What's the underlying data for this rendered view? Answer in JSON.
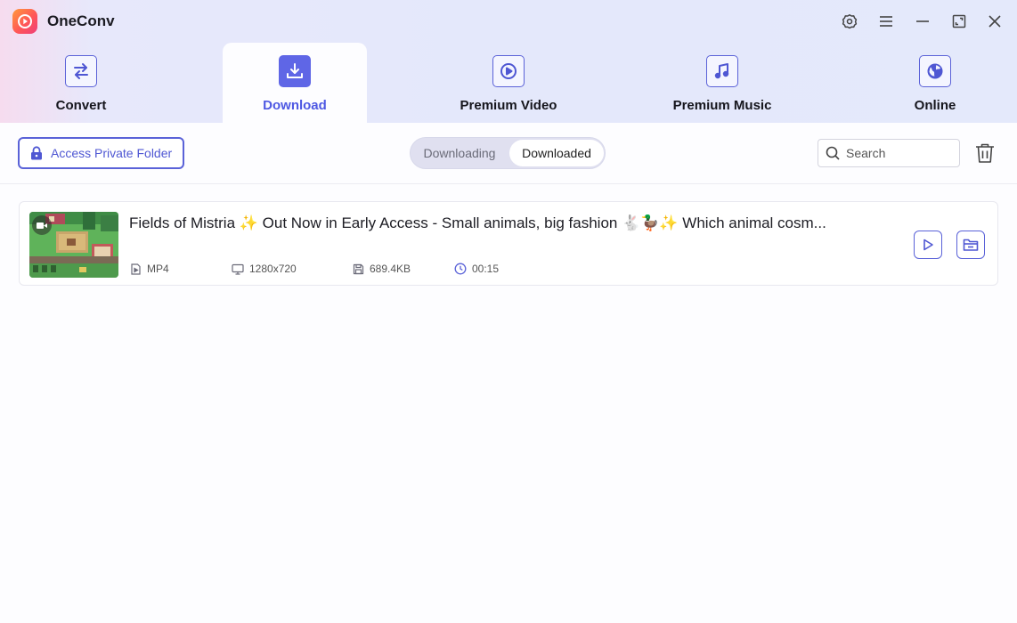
{
  "app": {
    "title": "OneConv"
  },
  "window_controls": [
    {
      "name": "settings-icon"
    },
    {
      "name": "menu-icon"
    },
    {
      "name": "minimize-icon"
    },
    {
      "name": "maximize-icon"
    },
    {
      "name": "close-icon"
    }
  ],
  "nav": {
    "active": "Download",
    "tabs": [
      {
        "label": "Convert",
        "icon": "convert-icon"
      },
      {
        "label": "Download",
        "icon": "download-icon"
      },
      {
        "label": "Premium Video",
        "icon": "play-circle-icon"
      },
      {
        "label": "Premium Music",
        "icon": "music-note-icon"
      },
      {
        "label": "Online",
        "icon": "globe-icon"
      }
    ]
  },
  "toolbar": {
    "private_folder_label": "Access Private Folder",
    "segment": {
      "downloading": "Downloading",
      "downloaded": "Downloaded",
      "selected": "Downloaded"
    },
    "search_placeholder": "Search"
  },
  "downloads": [
    {
      "title": "Fields of Mistria ✨ Out Now in Early Access - Small animals, big fashion 🐇🦆✨ Which animal cosm...",
      "format": "MP4",
      "resolution": "1280x720",
      "size": "689.4KB",
      "duration": "00:15"
    }
  ],
  "colors": {
    "accent": "#5a62d8",
    "active_tab_text": "#4e58e3"
  }
}
